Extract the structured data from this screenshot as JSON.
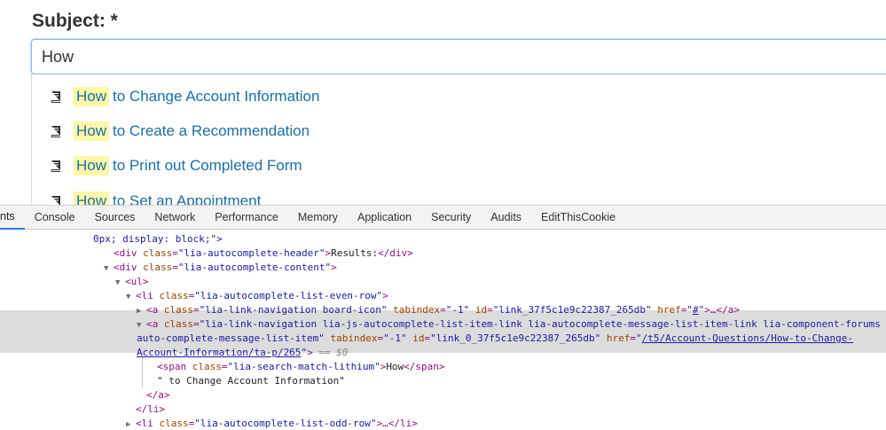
{
  "form": {
    "subject_label": "Subject: *",
    "subject_value": "How"
  },
  "autocomplete": {
    "items": [
      {
        "match": "How",
        "rest": "to Change Account Information"
      },
      {
        "match": "How",
        "rest": "to Create a Recommendation"
      },
      {
        "match": "How",
        "rest": "to Print out Completed Form"
      },
      {
        "match": "How",
        "rest": "to Set an Appointment"
      }
    ]
  },
  "devtools": {
    "tabs": [
      "nts",
      "Console",
      "Sources",
      "Network",
      "Performance",
      "Memory",
      "Application",
      "Security",
      "Audits",
      "EditThisCookie"
    ],
    "code": {
      "l0": "0px; display: block;\">",
      "l1_tag1": "<div",
      "l1_attr": "class",
      "l1_val": "\"lia-autocomplete-header\"",
      "l1_tagclose": ">",
      "l1_text": "Results:",
      "l1_end": "</div>",
      "l2_tag": "<div",
      "l2_attr": "class",
      "l2_val": "\"lia-autocomplete-content\"",
      "l2_close": ">",
      "l3_tag": "<ul>",
      "l4_tag": "<li",
      "l4_attr": "class",
      "l4_val": "\"lia-autocomplete-list-even-row\"",
      "l4_close": ">",
      "l5_tag": "<a",
      "l5_a1": "class",
      "l5_v1": "\"lia-link-navigation board-icon\"",
      "l5_a2": "tabindex",
      "l5_v2": "\"-1\"",
      "l5_a3": "id",
      "l5_v3": "\"link_37f5c1e9c22387_265db\"",
      "l5_a4": "href",
      "l5_v4q": "\"",
      "l5_v4": "#",
      "l5_v4q2": "\"",
      "l5_close": ">…</a>",
      "l6_tag": "<a",
      "l6_a1": "class",
      "l6_v1": "\"lia-link-navigation lia-js-autocomplete-list-item-link lia-autocomplete-message-list-item-link lia-component-forums",
      "l7_v1": "auto-complete-message-list-item\"",
      "l7_a2": "tabindex",
      "l7_v2": "\"-1\"",
      "l7_a3": "id",
      "l7_v3": "\"link_0_37f5c1e9c22387_265db\"",
      "l7_a4": "href",
      "l7_q": "\"",
      "l7_v4": "/t5/Account-Questions/How-to-Change-",
      "l8_v4": "Account-Information/ta-p/265",
      "l8_q": "\"",
      "l8_close": ">",
      "l8_sel": " == $0",
      "l9_tag": "<span",
      "l9_attr": "class",
      "l9_val": "\"lia-search-match-lithium\"",
      "l9_gt": ">",
      "l9_text": "How",
      "l9_end": "</span>",
      "l10_text": "\" to Change Account Information\"",
      "l11_end": "</a>",
      "l12_end": "</li>",
      "l13_tag": "<li",
      "l13_attr": "class",
      "l13_val": "\"lia-autocomplete-list-odd-row\"",
      "l13_close": ">…</li>"
    }
  }
}
